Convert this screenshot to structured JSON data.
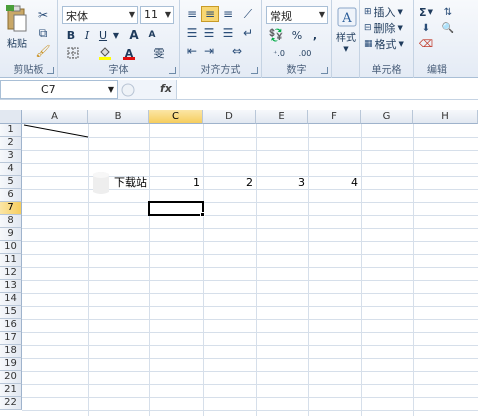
{
  "ribbon": {
    "clipboard": {
      "paste_label": "粘贴",
      "group_label": "剪贴板"
    },
    "font": {
      "name": "宋体",
      "size": "11",
      "bold": "B",
      "italic": "I",
      "underline": "U",
      "font_color_letter": "A",
      "phonetic": "雯",
      "group_label": "字体"
    },
    "alignment": {
      "group_label": "对齐方式"
    },
    "number": {
      "format": "常规",
      "percent": "%",
      "comma": ",",
      "group_label": "数字"
    },
    "styles": {
      "label": "样式"
    },
    "cells": {
      "insert": "插入",
      "delete": "删除",
      "format": "格式",
      "group_label": "单元格"
    },
    "editing": {
      "sigma": "Σ",
      "group_label": "编辑"
    }
  },
  "formula_bar": {
    "name_box": "C7",
    "fx": "fx",
    "formula": ""
  },
  "sheet": {
    "columns": [
      "A",
      "B",
      "C",
      "D",
      "E",
      "F",
      "G",
      "H"
    ],
    "selected_column": "C",
    "rows": [
      "1",
      "2",
      "3",
      "4",
      "5",
      "6",
      "7",
      "8",
      "9",
      "10",
      "11",
      "12",
      "13",
      "14",
      "15",
      "16",
      "17",
      "18",
      "19",
      "20",
      "21",
      "22"
    ],
    "selected_row": "7",
    "cells": {
      "B5": "下载站",
      "C5": "1",
      "D5": "2",
      "E5": "3",
      "F5": "4"
    }
  }
}
